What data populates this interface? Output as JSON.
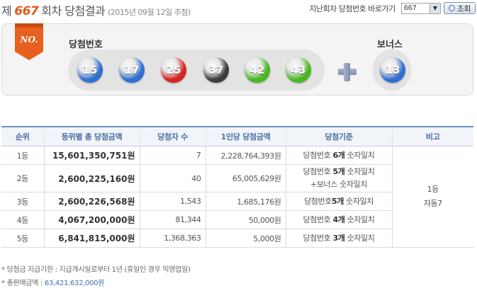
{
  "header": {
    "prefix": "제",
    "draw_no": "667",
    "suffix": "회차 당첨결과",
    "date": "(2015년 09월 12일 추첨)",
    "jump_label": "지난회차 당첨번호 바로가기",
    "selected_draw": "667",
    "search_button": "조회"
  },
  "result": {
    "badge": "NO.",
    "win_label": "당첨번호",
    "bonus_label": "보너스",
    "numbers": [
      {
        "value": "15",
        "color": "#2f6fd0"
      },
      {
        "value": "17",
        "color": "#2f6fd0"
      },
      {
        "value": "25",
        "color": "#d8231f"
      },
      {
        "value": "37",
        "color": "#3c3c3c"
      },
      {
        "value": "42",
        "color": "#47b820"
      },
      {
        "value": "43",
        "color": "#47b820"
      }
    ],
    "bonus": {
      "value": "13",
      "color": "#2f6fd0"
    }
  },
  "table": {
    "headers": [
      "순위",
      "등위별 총 당첨금액",
      "당첨자 수",
      "1인당 당첨금액",
      "당첨기준",
      "비고"
    ],
    "rows": [
      {
        "rank": "1등",
        "total": "15,601,350,751원",
        "winners": "7",
        "per": "2,228,764,393원",
        "crit_pre": "당첨번호 ",
        "crit_bold": "6개",
        "crit_post": " 숫자일치",
        "crit2": ""
      },
      {
        "rank": "2등",
        "total": "2,600,225,160원",
        "winners": "40",
        "per": "65,005,629원",
        "crit_pre": "당첨번호 ",
        "crit_bold": "5개",
        "crit_post": " 숫자일치",
        "crit2": "+보너스 숫자일치"
      },
      {
        "rank": "3등",
        "total": "2,600,226,568원",
        "winners": "1,543",
        "per": "1,685,176원",
        "crit_pre": "당첨번호",
        "crit_bold": "5개",
        "crit_post": " 숫자일치",
        "crit2": ""
      },
      {
        "rank": "4등",
        "total": "4,067,200,000원",
        "winners": "81,344",
        "per": "50,000원",
        "crit_pre": "당첨번호 ",
        "crit_bold": "4개",
        "crit_post": " 숫자일치",
        "crit2": ""
      },
      {
        "rank": "5등",
        "total": "6,841,815,000원",
        "winners": "1,368,363",
        "per": "5,000원",
        "crit_pre": "당첨번호 ",
        "crit_bold": "3개",
        "crit_post": " 숫자일치",
        "crit2": ""
      }
    ],
    "note_line1": "1등",
    "note_line2": "자동7"
  },
  "footer": {
    "deadline": "* 당첨금 지급기한 : 지급개시일로부터 1년 (휴일인 경우 익영업일)",
    "sales_label": "* 총판매금액 : ",
    "sales_amount": "63,421,632,000원"
  },
  "colors": {
    "accent": "#e4571b",
    "table_header_text": "#4a6fa5",
    "blue_ball": "#2f6fd0",
    "red_ball": "#d8231f",
    "gray_ball": "#3c3c3c",
    "green_ball": "#47b820"
  }
}
